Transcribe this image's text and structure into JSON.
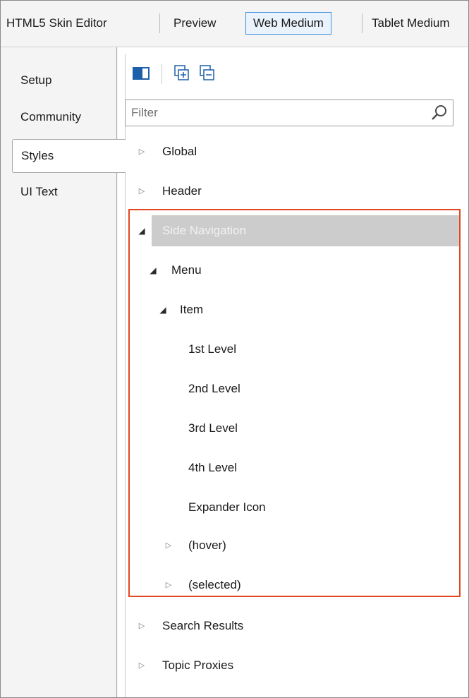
{
  "toolbar": {
    "items": [
      "HTML5 Skin Editor",
      "Preview",
      "Web Medium",
      "Tablet Medium"
    ],
    "active": "Web Medium"
  },
  "left_tabs": {
    "setup": "Setup",
    "community": "Community",
    "styles": "Styles",
    "ui_text": "UI Text",
    "selected": "Styles"
  },
  "panel": {
    "tools": [
      "panel-toggle-icon",
      "expand-all-icon",
      "collapse-all-icon"
    ],
    "filter": {
      "placeholder": "Filter",
      "value": ""
    }
  },
  "tree": {
    "global": "Global",
    "header": "Header",
    "side_navigation": "Side Navigation",
    "menu": "Menu",
    "item": "Item",
    "level1": "1st Level",
    "level2": "2nd Level",
    "level3": "3rd Level",
    "level4": "4th Level",
    "expander_icon": "Expander Icon",
    "hover": "(hover)",
    "selected": "(selected)",
    "search_results": "Search Results",
    "topic_proxies": "Topic Proxies",
    "selected_node": "Side Navigation"
  },
  "colors": {
    "highlight": "#e2471f",
    "active_toolbar": "#3c8edc",
    "selected_row": "#cccccc",
    "icon_blue": "#1d5fa8"
  }
}
